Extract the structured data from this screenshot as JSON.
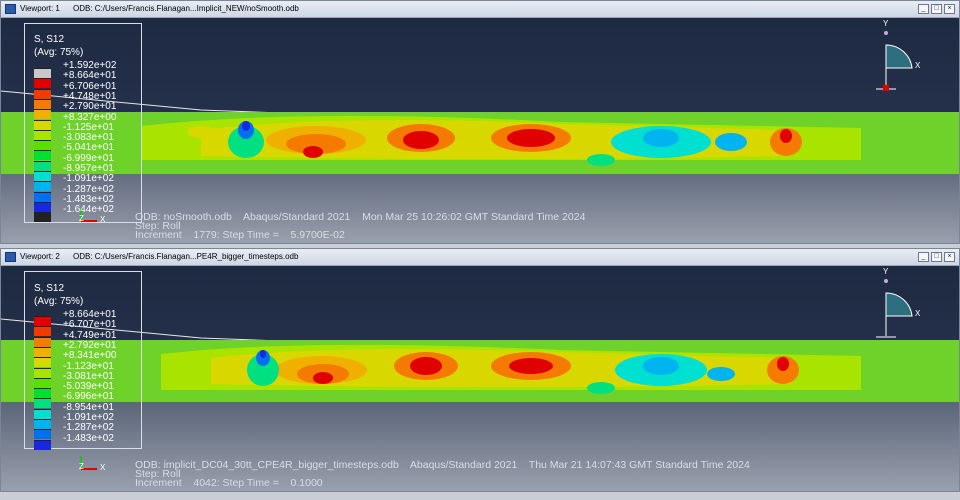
{
  "colors": {
    "window_top": "#1e2a41",
    "window_bottom": "#8b93a3",
    "band_green": "#6ed22a"
  },
  "viewports": [
    {
      "title": "Viewport: 1",
      "odb_path": "ODB: C:/Users/Francis.Flanagan...Implicit_NEW/noSmooth.odb",
      "legend": {
        "title": "S, S12",
        "subtitle": "(Avg: 75%)",
        "colors": [
          "#c8c8c8",
          "#e00000",
          "#f03a00",
          "#f57a00",
          "#f0b000",
          "#d8d800",
          "#a8e400",
          "#5ae000",
          "#00e030",
          "#00e080",
          "#00e0d0",
          "#00b4f0",
          "#0070f0",
          "#1828e0",
          "#222222"
        ],
        "labels": [
          "+1.592e+02",
          "+8.664e+01",
          "+6.706e+01",
          "+4.748e+01",
          "+2.790e+01",
          "+8.327e+00",
          "-1.125e+01",
          "-3.083e+01",
          "-5.041e+01",
          "-6.999e+01",
          "-8.957e+01",
          "-1.091e+02",
          "-1.287e+02",
          "-1.483e+02",
          "-1.644e+02"
        ]
      },
      "info": {
        "odb_line": "ODB: noSmooth.odb    Abaqus/Standard 2021    Mon Mar 25 10:26:02 GMT Standard Time 2024",
        "step_line": "Step: Roll",
        "increment_line": "Increment    1779: Step Time =    5.9700E-02"
      }
    },
    {
      "title": "Viewport: 2",
      "odb_path": "ODB: C:/Users/Francis.Flanagan...PE4R_bigger_timesteps.odb",
      "legend": {
        "title": "S, S12",
        "subtitle": "(Avg: 75%)",
        "colors": [
          "#e00000",
          "#f03a00",
          "#f57a00",
          "#f0b000",
          "#d8d800",
          "#a8e400",
          "#5ae000",
          "#00e030",
          "#00e080",
          "#00e0d0",
          "#00b4f0",
          "#0070f0",
          "#1828e0"
        ],
        "labels": [
          "+8.664e+01",
          "+6.707e+01",
          "+4.749e+01",
          "+2.792e+01",
          "+8.341e+00",
          "-1.123e+01",
          "-3.081e+01",
          "-5.039e+01",
          "-6.996e+01",
          "-8.954e+01",
          "-1.091e+02",
          "-1.287e+02",
          "-1.483e+02"
        ]
      },
      "info": {
        "odb_line": "ODB: implicit_DC04_30tt_CPE4R_bigger_timesteps.odb    Abaqus/Standard 2021    Thu Mar 21 14:07:43 GMT Standard Time 2024",
        "step_line": "Step: Roll",
        "increment_line": "Increment    4042: Step Time =    0.1000"
      }
    }
  ],
  "triad": {
    "x": "X",
    "y": "Y",
    "z": "Z"
  }
}
